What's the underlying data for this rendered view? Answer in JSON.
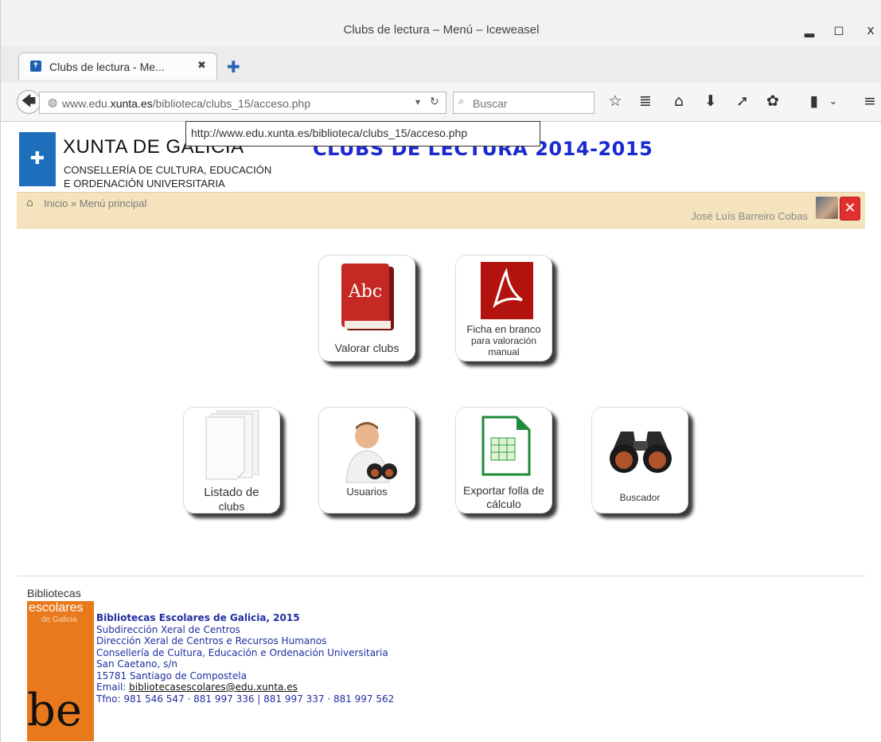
{
  "window": {
    "title": "Clubs de lectura – Menú – Iceweasel",
    "controls": {
      "minimize": "▂",
      "maximize": "◻",
      "close": "x"
    }
  },
  "tab": {
    "label": "Clubs de lectura - Me...",
    "close": "✖",
    "new_tab": "✚"
  },
  "navbar": {
    "back": "🡄",
    "url_prefix": "www.edu.",
    "url_domain": "xunta.es",
    "url_path": "/biblioteca/clubs_15/acceso.php",
    "search_placeholder": "Buscar"
  },
  "tooltip": "http://www.edu.xunta.es/biblioteca/clubs_15/acceso.php",
  "header": {
    "org": "XUNTA DE GALICIA",
    "consellaria_line1": "CONSELLERÍA DE CULTURA, EDUCACIÓN",
    "consellaria_line2": "E ORDENACIÓN UNIVERSITARIA",
    "page_title": "CLUBS DE LECTURA 2014-2015"
  },
  "breadcrumb": {
    "text": "Inicio » Menú principal",
    "user": "José Luís Barreiro Cobas"
  },
  "tiles": {
    "valorar": "Valorar clubs",
    "ficha_line1": "Ficha en branco",
    "ficha_line2": "para valoración",
    "ficha_line3": "manual",
    "listado_line1": "Listado de",
    "listado_line2": "clubs",
    "usuarios": "Usuarios",
    "exportar_line1": "Exportar folla de",
    "exportar_line2": "cálculo",
    "buscador": "Buscador",
    "abc_text": "Abc"
  },
  "footer": {
    "logo_title": "Bibliotecas",
    "logo_escolares": "escolares",
    "logo_galicia": "de Galicia",
    "logo_mark": "be",
    "line1": "Bibliotecas Escolares de Galicia, 2015",
    "line2": "Subdirección Xeral de Centros",
    "line3": "Dirección Xeral de Centros e Recursos Humanos",
    "line4": "Consellería de Cultura, Educación e Ordenación Universitaria",
    "line5": "San Caetano, s/n",
    "line6": "15781 Santiago de Compostela",
    "email_label": "Email: ",
    "email": "bibliotecasescolares@edu.xunta.es",
    "phones": "Tfno: 981 546 547 · 881 997 336 | 881 997 337 · 881 997 562"
  },
  "colors": {
    "accent_title": "#1a2ad0",
    "breadcrumb_bg": "#f4e3bd",
    "logo_blue": "#1e6fbb",
    "bib_orange": "#e87a1d"
  }
}
